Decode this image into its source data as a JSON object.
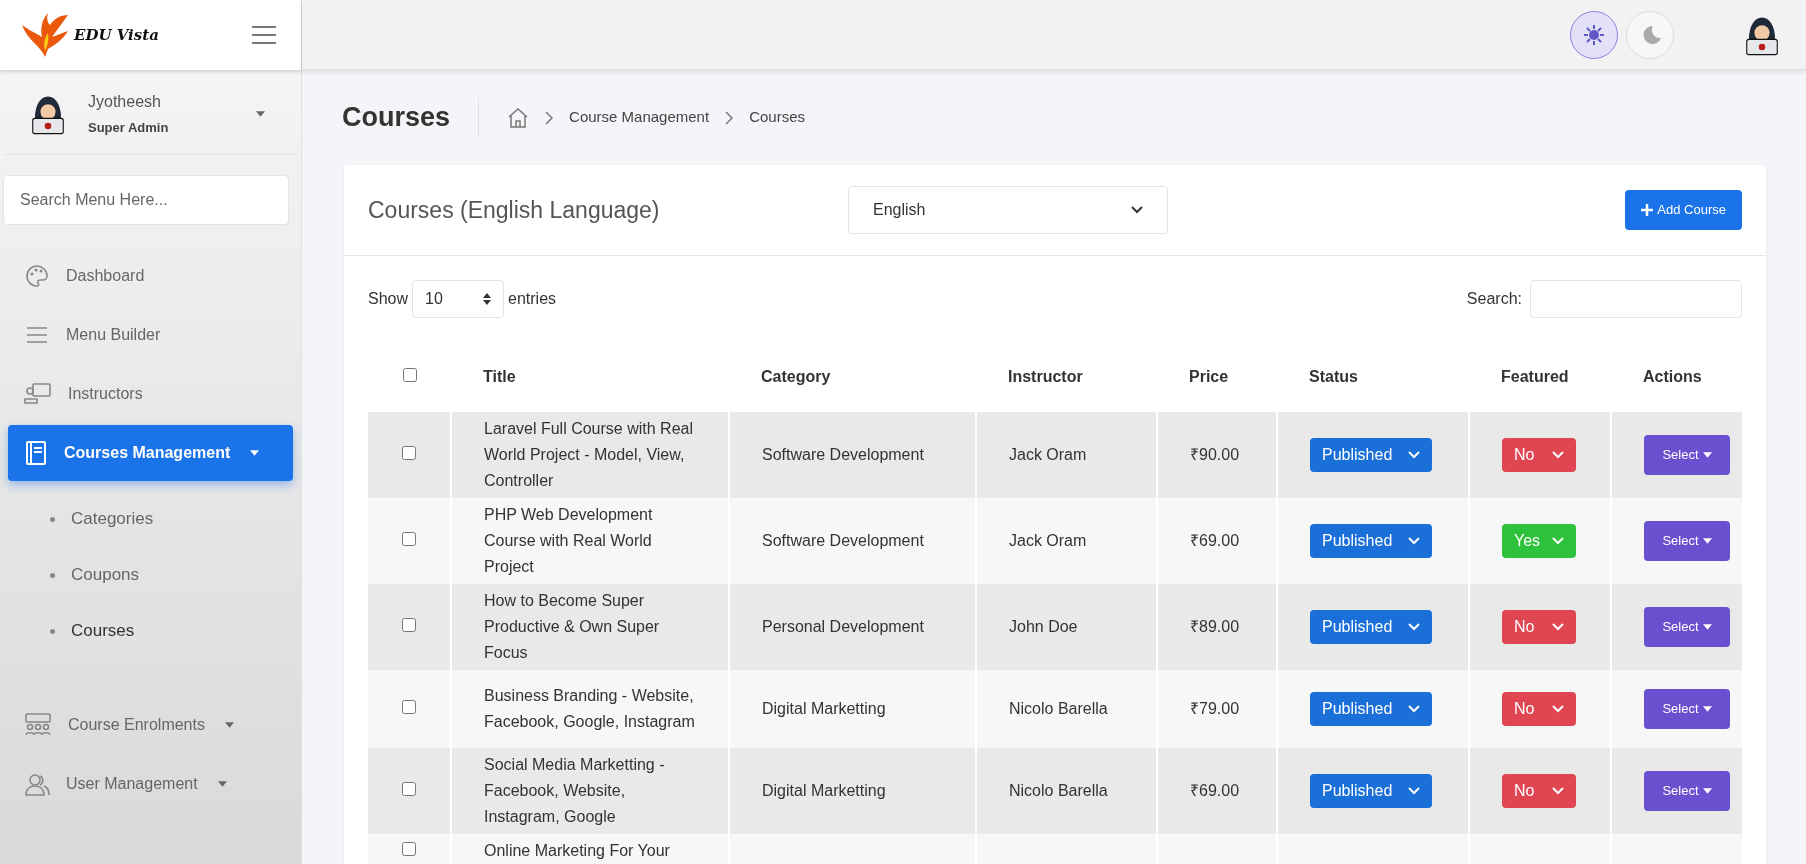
{
  "brand": {
    "name": "EDU Vista"
  },
  "theme_toggle": [
    {
      "selected": true
    },
    {
      "selected": false
    }
  ],
  "user": {
    "name": "Jyotheesh",
    "role": "Super Admin"
  },
  "sidebar": {
    "search": {
      "placeholder": "Search Menu Here..."
    },
    "items": [
      {
        "label": "Dashboard",
        "selected": false,
        "has_caret": false
      },
      {
        "label": "Menu Builder",
        "selected": false,
        "has_caret": false
      },
      {
        "label": "Instructors",
        "selected": false,
        "has_caret": false
      },
      {
        "label": "Courses Management",
        "selected": true,
        "has_caret": true,
        "children": [
          {
            "label": "Categories",
            "selected": false
          },
          {
            "label": "Coupons",
            "selected": false
          },
          {
            "label": "Courses",
            "selected": true
          }
        ]
      },
      {
        "label": "Course Enrolments",
        "selected": false,
        "has_caret": true
      },
      {
        "label": "User Management",
        "selected": false,
        "has_caret": true
      }
    ]
  },
  "page_title": "Courses",
  "breadcrumb": [
    "Course Management",
    "Courses"
  ],
  "card": {
    "title": "Courses (English Language)",
    "language_select": "English",
    "add_button": "Add Course",
    "show_label": "Show",
    "entries_value": "10",
    "entries_label": "entries",
    "search_label": "Search:"
  },
  "table": {
    "all_checked": false,
    "columns": [
      "Title",
      "Category",
      "Instructor",
      "Price",
      "Status",
      "Featured",
      "Actions"
    ],
    "rows": [
      {
        "checked": false,
        "title": "Laravel Full Course with Real World Project - Model, View, Controller",
        "category": "Software Development",
        "instructor": "Jack Oram",
        "price": "₹90.00",
        "status": "Published",
        "featured": {
          "label": "No",
          "on": false
        },
        "action": "Select"
      },
      {
        "checked": false,
        "title": "PHP Web Development Course with Real World Project",
        "category": "Software Development",
        "instructor": "Jack Oram",
        "price": "₹69.00",
        "status": "Published",
        "featured": {
          "label": "Yes",
          "on": true
        },
        "action": "Select"
      },
      {
        "checked": false,
        "title": "How to Become Super Productive & Own Super Focus",
        "category": "Personal Development",
        "instructor": "John Doe",
        "price": "₹89.00",
        "status": "Published",
        "featured": {
          "label": "No",
          "on": false
        },
        "action": "Select"
      },
      {
        "checked": false,
        "title": "Business Branding - Website, Facebook, Google, Instagram",
        "category": "Digital Marketting",
        "instructor": "Nicolo Barella",
        "price": "₹79.00",
        "status": "Published",
        "featured": {
          "label": "No",
          "on": false
        },
        "action": "Select"
      },
      {
        "checked": false,
        "title": "Social Media Marketting - Facebook, Website, Instagram, Google",
        "category": "Digital Marketting",
        "instructor": "Nicolo Barella",
        "price": "₹69.00",
        "status": "Published",
        "featured": {
          "label": "No",
          "on": false
        },
        "action": "Select"
      },
      {
        "checked": false,
        "title": "Online Marketing For Your"
      }
    ]
  }
}
